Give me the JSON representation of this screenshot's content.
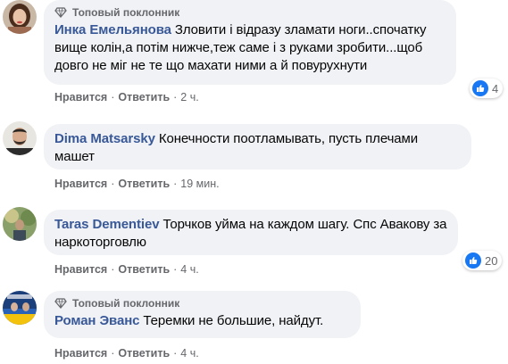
{
  "accent_link": "#385898",
  "like_color": "#1877f2",
  "comments": [
    {
      "badge": "Топовый поклонник",
      "author": "Инка Емельянова",
      "text": "Зловити і відразу зламати ноги..спочатку вище колін,а потім нижче,теж саме і з руками зробити...щоб довго не міг не те що махати ними а й повурухнути",
      "like": "Нравится",
      "reply": "Ответить",
      "time": "2 ч.",
      "reactions": "4",
      "reaction_icon": "like-icon"
    },
    {
      "badge": "",
      "author": "Dima Matsarsky",
      "text": "Конечности поотламывать, пусть плечами машет",
      "like": "Нравится",
      "reply": "Ответить",
      "time": "19 мин.",
      "reactions": "",
      "reaction_icon": ""
    },
    {
      "badge": "",
      "author": "Taras Dementiev",
      "text": "Торчков уйма на каждом шагу. Спс Авакову за наркоторговлю",
      "like": "Нравится",
      "reply": "Ответить",
      "time": "4 ч.",
      "reactions": "20",
      "reaction_icon": "like-icon"
    },
    {
      "badge": "Топовый поклонник",
      "author": "Роман Эванс",
      "text": "Теремки не большие, найдут.",
      "like": "Нравится",
      "reply": "Ответить",
      "time": "4 ч.",
      "reactions": "",
      "reaction_icon": ""
    }
  ]
}
